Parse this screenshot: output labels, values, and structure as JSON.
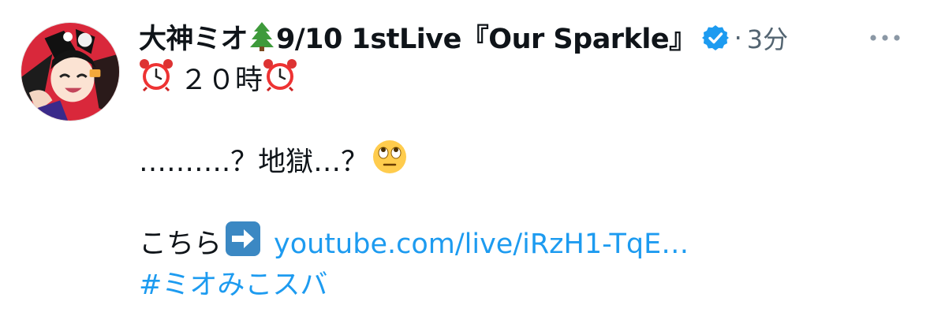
{
  "tweet": {
    "author": {
      "display_name_part1": "大神ミオ",
      "display_name_emoji": "tree-icon",
      "display_name_part2": "9/10 1stLive『Our Sparkle』",
      "verified": true,
      "avatar": "avatar"
    },
    "meta": {
      "separator": "·",
      "time_ago": "3分"
    },
    "more_icon": "more-icon",
    "text": {
      "line1_text": "２０時",
      "line1_icon": "alarm-clock-icon",
      "line2_text": "……….？地獄…？",
      "line2_icon": "eye-roll-emoji-icon",
      "line3_text": "こちら",
      "line3_icon": "right-arrow-icon",
      "link": "youtube.com/live/iRzH1-TqE…",
      "hashtag": "#ミオみこスバ"
    },
    "colors": {
      "link": "#1d9bf0",
      "meta": "#536471",
      "verified": "#1d9bf0"
    }
  }
}
